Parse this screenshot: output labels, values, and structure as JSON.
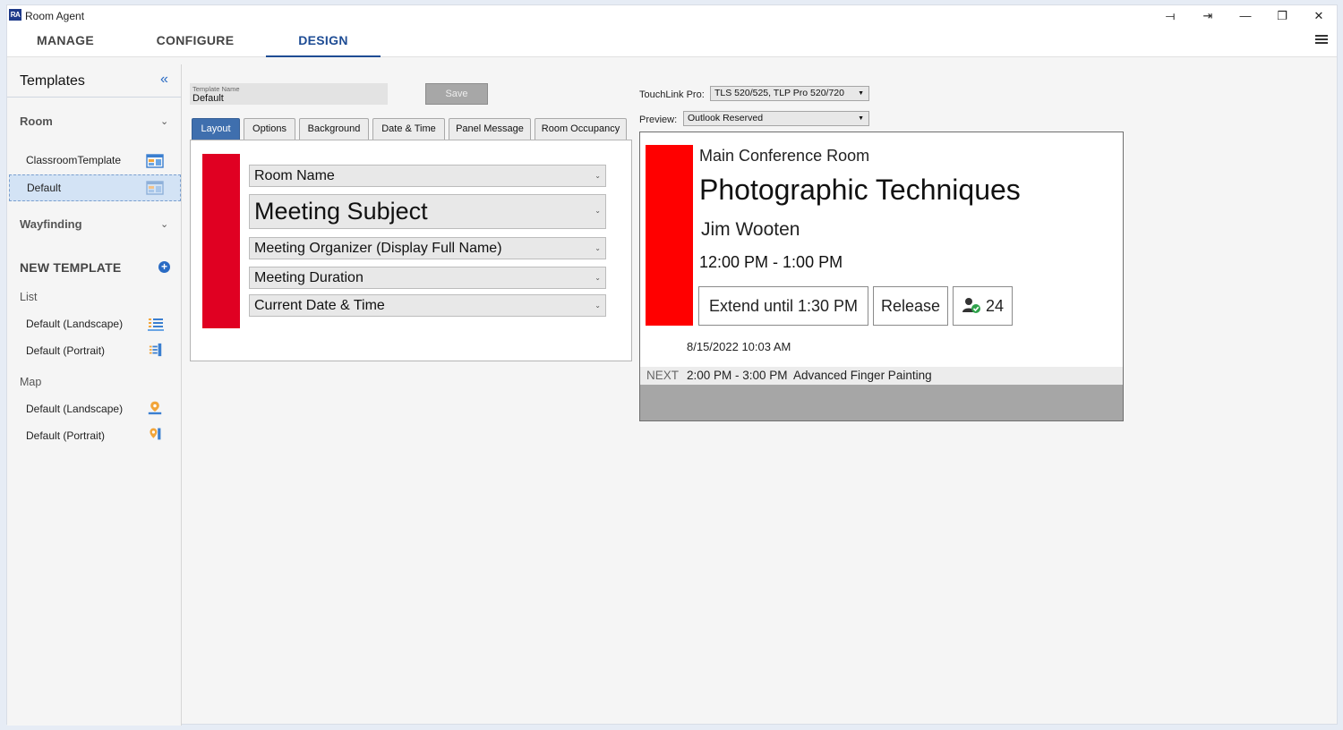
{
  "window": {
    "title": "Room Agent",
    "icon_text": "RA",
    "controls": [
      "⟞",
      "⇥",
      "—",
      "❐",
      "✕"
    ]
  },
  "nav": {
    "tabs": [
      {
        "label": "MANAGE"
      },
      {
        "label": "CONFIGURE"
      },
      {
        "label": "DESIGN"
      }
    ],
    "active": "DESIGN"
  },
  "sidebar": {
    "title": "Templates",
    "collapse_glyph": "«",
    "room_section": "Room",
    "room_items": [
      {
        "label": "ClassroomTemplate"
      },
      {
        "label": "Default"
      }
    ],
    "wayfinding_section": "Wayfinding",
    "new_template": "NEW TEMPLATE",
    "list_label": "List",
    "list_items": [
      {
        "label": "Default (Landscape)"
      },
      {
        "label": "Default (Portrait)"
      }
    ],
    "map_label": "Map",
    "map_items": [
      {
        "label": "Default (Landscape)"
      },
      {
        "label": "Default (Portrait)"
      }
    ]
  },
  "editor": {
    "template_name_label": "Template Name",
    "template_name_value": "Default",
    "save_label": "Save",
    "tabs": [
      "Layout",
      "Options",
      "Background",
      "Date & Time",
      "Panel Message",
      "Room Occupancy"
    ],
    "active_tab": "Layout",
    "fields": [
      {
        "label": "Room Name"
      },
      {
        "label": "Meeting Subject"
      },
      {
        "label": "Meeting Organizer (Display Full Name)"
      },
      {
        "label": "Meeting Duration"
      },
      {
        "label": "Current Date & Time"
      }
    ],
    "accent_color": "#e00022"
  },
  "preview_controls": {
    "touchlink_label": "TouchLink Pro:",
    "touchlink_value": "TLS 520/525, TLP Pro 520/720",
    "preview_label": "Preview:",
    "preview_value": "Outlook Reserved"
  },
  "preview": {
    "room": "Main Conference Room",
    "subject": "Photographic Techniques",
    "organizer": "Jim Wooten",
    "time": "12:00 PM - 1:00 PM",
    "extend_label": "Extend until 1:30 PM",
    "release_label": "Release",
    "occupancy_count": "24",
    "date": "8/15/2022 10:03 AM",
    "next_key": "NEXT",
    "next_time": "2:00 PM - 3:00 PM",
    "next_subject": "Advanced Finger Painting",
    "status_color": "#ff0000"
  }
}
